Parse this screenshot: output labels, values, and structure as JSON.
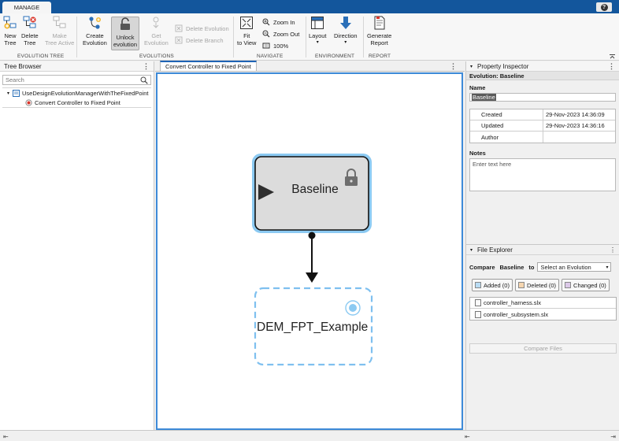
{
  "ribbon": {
    "tab": "MANAGE",
    "help_glyph": "?",
    "groups": {
      "evolution_tree": "EVOLUTION TREE",
      "evolutions": "EVOLUTIONS",
      "navigate": "NAVIGATE",
      "environment": "ENVIRONMENT",
      "report": "REPORT"
    },
    "buttons": {
      "new_tree": [
        "New",
        "Tree"
      ],
      "delete_tree": [
        "Delete",
        "Tree"
      ],
      "make_tree_active": [
        "Make",
        "Tree Active"
      ],
      "create_evolution": [
        "Create",
        "Evolution"
      ],
      "unlock_evolution": [
        "Unlock",
        "evolution"
      ],
      "get_evolution": [
        "Get",
        "Evolution"
      ],
      "delete_evolution": "Delete Evolution",
      "delete_branch": "Delete Branch",
      "fit_to_view": [
        "Fit",
        "to View"
      ],
      "zoom_in": "Zoom In",
      "zoom_out": "Zoom Out",
      "zoom_level": "100%",
      "layout": "Layout",
      "direction": "Direction",
      "generate_report": [
        "Generate",
        "Report"
      ]
    }
  },
  "tree_browser": {
    "title": "Tree Browser",
    "search_placeholder": "Search",
    "items": [
      {
        "label": "UseDesignEvolutionManagerWithTheFixedPoint",
        "level": 0
      },
      {
        "label": "Convert Controller to Fixed Point",
        "level": 1
      }
    ]
  },
  "document": {
    "tab": "Convert Controller to Fixed Point",
    "nodes": {
      "baseline": "Baseline",
      "child": "DEM_FPT_Example"
    }
  },
  "property_inspector": {
    "title": "Property Inspector",
    "header": "Evolution: Baseline",
    "name_label": "Name",
    "name_value": "Baseline",
    "meta": [
      {
        "key": "Created",
        "value": "29-Nov-2023 14:36:09"
      },
      {
        "key": "Updated",
        "value": "29-Nov-2023 14:36:16"
      },
      {
        "key": "Author",
        "value": ""
      }
    ],
    "notes_label": "Notes",
    "notes_placeholder": "Enter text here"
  },
  "file_explorer": {
    "title": "File Explorer",
    "compare_label": "Compare",
    "compare_evolution": "Baseline",
    "to_label": "to",
    "select_placeholder": "Select an Evolution",
    "filters": [
      {
        "label": "Added (0)",
        "color": "#b9dcf4"
      },
      {
        "label": "Deleted (0)",
        "color": "#f6d6b0"
      },
      {
        "label": "Changed (0)",
        "color": "#dcc9e8"
      }
    ],
    "files": [
      "controller_harness.slx",
      "controller_subsystem.slx"
    ],
    "compare_files": "Compare Files"
  },
  "colors": {
    "accent": "#13569c",
    "canvas_border": "#3d8ad8",
    "node_border": "#5aaae6",
    "node_fill": "#dcdcdc",
    "dashed_border": "#7fc0ef"
  }
}
